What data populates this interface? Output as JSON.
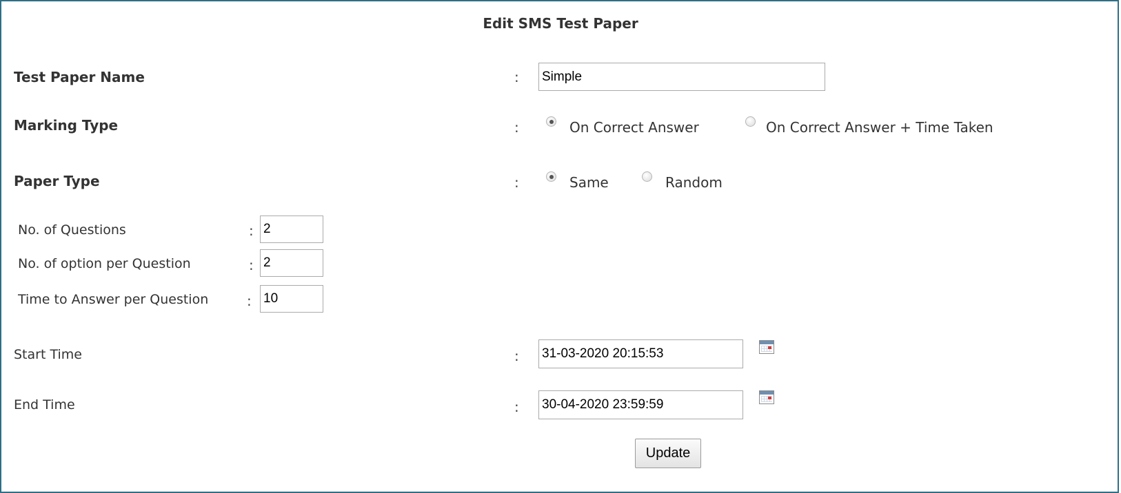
{
  "form": {
    "title": "Edit SMS Test Paper",
    "colon": ":",
    "test_paper_name": {
      "label": "Test Paper Name",
      "value": "Simple"
    },
    "marking_type": {
      "label": "Marking Type",
      "options": [
        {
          "label": "On Correct Answer",
          "checked": true
        },
        {
          "label": "On Correct Answer + Time Taken",
          "checked": false
        }
      ]
    },
    "paper_type": {
      "label": "Paper Type",
      "options": [
        {
          "label": "Same",
          "checked": true
        },
        {
          "label": "Random",
          "checked": false
        }
      ]
    },
    "sub_fields": [
      {
        "label": "No. of Questions",
        "value": "2"
      },
      {
        "label": "No. of option per Question",
        "value": "2"
      },
      {
        "label": "Time to Answer per Question",
        "value": "10"
      }
    ],
    "start_time": {
      "label": "Start Time",
      "value": "31-03-2020 20:15:53",
      "icon": "calendar-icon"
    },
    "end_time": {
      "label": "End Time",
      "value": "30-04-2020 23:59:59",
      "icon": "calendar-icon"
    },
    "update_button": "Update"
  }
}
